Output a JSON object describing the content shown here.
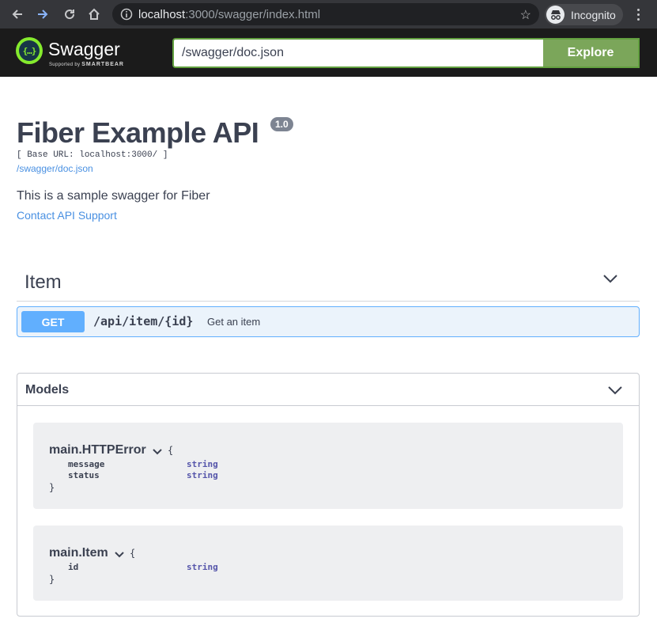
{
  "browser": {
    "url_host": "localhost",
    "url_path": ":3000/swagger/index.html",
    "incognito_label": "Incognito"
  },
  "topbar": {
    "logo_text": "Swagger",
    "logo_supported": "Supported by",
    "logo_brand": "SMARTBEAR",
    "spec_url_value": "/swagger/doc.json",
    "explore_label": "Explore",
    "accent_color": "#7ba65a"
  },
  "info": {
    "title": "Fiber Example API",
    "version": "1.0",
    "base_url": "[ Base URL: localhost:3000/ ]",
    "spec_link": "/swagger/doc.json",
    "description": "This is a sample swagger for Fiber",
    "contact": "Contact API Support"
  },
  "tags": [
    {
      "name": "Item",
      "operations": [
        {
          "method": "GET",
          "path": "/api/item/{id}",
          "summary": "Get an item",
          "color": "#61affe"
        }
      ]
    }
  ],
  "models": {
    "title": "Models",
    "items": [
      {
        "name": "main.HTTPError",
        "open_brace": "{",
        "close_brace": "}",
        "properties": [
          {
            "name": "message",
            "type": "string"
          },
          {
            "name": "status",
            "type": "string"
          }
        ]
      },
      {
        "name": "main.Item",
        "open_brace": "{",
        "close_brace": "}",
        "properties": [
          {
            "name": "id",
            "type": "string"
          }
        ]
      }
    ]
  }
}
